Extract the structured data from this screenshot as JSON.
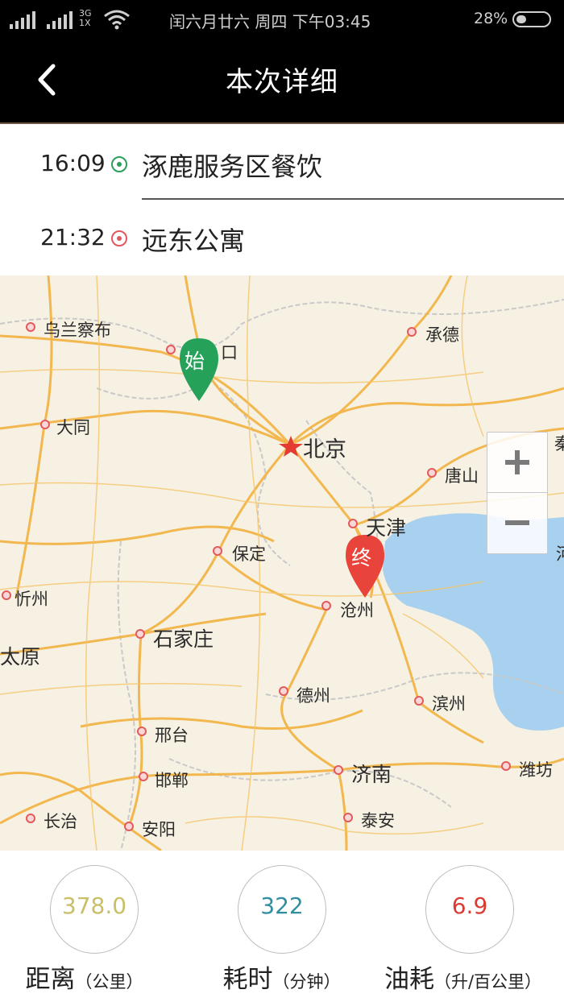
{
  "status_bar": {
    "network": "3G",
    "network_sub": "1X",
    "clock_text": "闰六月廿六  周四  下午03:45",
    "battery": "28%"
  },
  "header": {
    "title": "本次详细"
  },
  "trip": {
    "start": {
      "time": "16:09",
      "place": "涿鹿服务区餐饮"
    },
    "end": {
      "time": "21:32",
      "place": "远东公寓"
    }
  },
  "map": {
    "start_marker": "始",
    "end_marker": "终",
    "cities": {
      "wulanchabu": "乌兰察布",
      "zhangjiakou": "口",
      "chengde": "承德",
      "datong": "大同",
      "beijing": "北京",
      "tangshan": "唐山",
      "tianjin": "天津",
      "baoding": "保定",
      "xinzhou": "忻州",
      "cangzhou": "沧州",
      "shijiazhuang": "石家庄",
      "taiyuan": "太原",
      "dezhou": "德州",
      "binzhou": "滨州",
      "xingtai": "邢台",
      "jinan": "济南",
      "weifang": "潍坊",
      "handan": "邯郸",
      "changzhi": "长治",
      "anyang": "安阳",
      "taian": "泰安",
      "edge_right_1": "秦",
      "edge_right_2": "河"
    },
    "zoom_in_icon": "plus-icon",
    "zoom_out_icon": "minus-icon"
  },
  "stats": {
    "distance": {
      "value": "378.0",
      "label": "距离",
      "unit": "（公里）",
      "color": "#c9bf67"
    },
    "duration": {
      "value": "322",
      "label": "耗时",
      "unit": "（分钟）",
      "color": "#2f8fa0"
    },
    "fuel": {
      "value": "6.9",
      "label": "油耗",
      "unit": "（升/百公里）",
      "color": "#d93a32"
    }
  },
  "colors": {
    "start_green": "#29a05c",
    "end_red": "#e2575c",
    "sea": "#a8d1ef",
    "road": "#f2b13f"
  }
}
